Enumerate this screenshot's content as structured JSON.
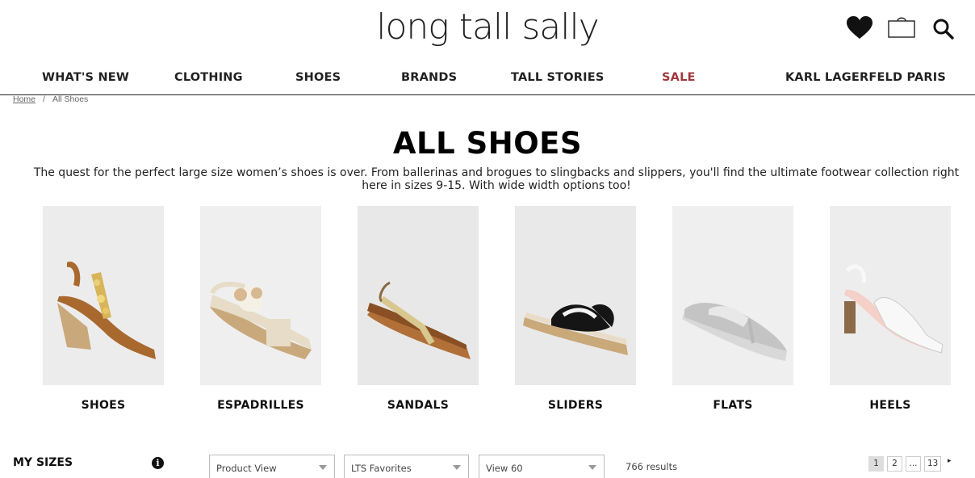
{
  "header": {
    "logo_text": "long tall sally",
    "icons": [
      "heart-icon",
      "bag-icon",
      "search-icon"
    ]
  },
  "nav": {
    "items": [
      {
        "label": "WHAT'S NEW"
      },
      {
        "label": "CLOTHING"
      },
      {
        "label": "SHOES"
      },
      {
        "label": "BRANDS"
      },
      {
        "label": "TALL STORIES"
      },
      {
        "label": "SALE"
      },
      {
        "label": "KARL LAGERFELD PARIS"
      }
    ],
    "sale_color": "#a0383f"
  },
  "breadcrumb": {
    "home": "Home",
    "separator": "/",
    "current": "All Shoes"
  },
  "page": {
    "title": "ALL SHOES",
    "intro": "The quest for the perfect large size women’s shoes is over. From ballerinas and brogues to slingbacks and slippers, you'll find the ultimate footwear collection right here in sizes 9-15. With wide width options too!"
  },
  "categories": [
    {
      "label": "SHOES"
    },
    {
      "label": "ESPADRILLES"
    },
    {
      "label": "SANDALS"
    },
    {
      "label": "SLIDERS"
    },
    {
      "label": "FLATS"
    },
    {
      "label": "HEELS"
    }
  ],
  "filters": {
    "my_sizes": "MY SIZES",
    "info_icon": "i",
    "view_select": "Product View",
    "sort_select": "LTS Favorites",
    "per_page_select": "View 60",
    "results": "766 results"
  },
  "pagination": {
    "pages": [
      "1",
      "2",
      "...",
      "13"
    ],
    "current": "1",
    "next": "▸"
  }
}
